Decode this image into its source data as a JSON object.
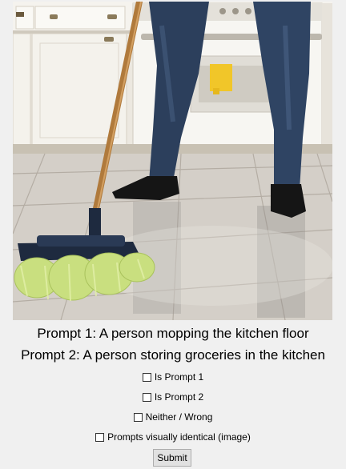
{
  "photo": {
    "alt": ""
  },
  "prompts": {
    "prompt1": "Prompt 1: A person mopping the kitchen floor",
    "prompt2": "Prompt 2: A person storing groceries in the kitchen"
  },
  "options": [
    {
      "label": "Is Prompt 1",
      "checked": false
    },
    {
      "label": "Is Prompt 2",
      "checked": false
    },
    {
      "label": "Neither / Wrong",
      "checked": false
    },
    {
      "label": "Prompts visually identical (image)",
      "checked": false
    }
  ],
  "submit_label": "Submit",
  "colors": {
    "background": "#f0f0f0",
    "jeans": "#2c3f5c",
    "mop_head": "#c9df7f",
    "mop_handle": "#b07a3c"
  }
}
